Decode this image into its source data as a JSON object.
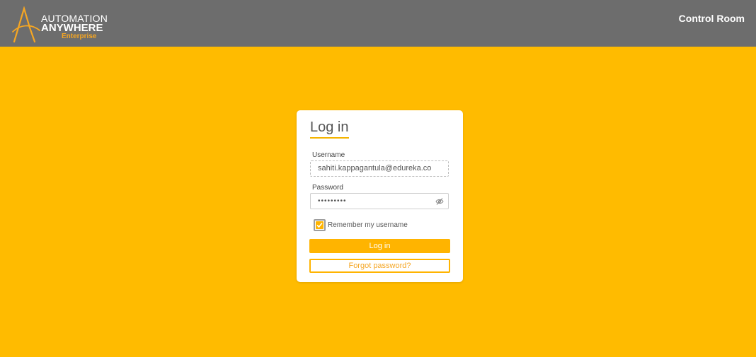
{
  "header": {
    "logo": {
      "line1": "AUTOMATION",
      "line2": "ANYWHERE",
      "line3": "Enterprise"
    },
    "right_link": "Control Room"
  },
  "login": {
    "title": "Log in",
    "username_label": "Username",
    "username_value": "sahiti.kappagantula@edureka.co",
    "password_label": "Password",
    "password_value": "•••••••••",
    "remember_label": "Remember my username",
    "remember_checked": true,
    "login_button": "Log in",
    "forgot_button": "Forgot password?"
  },
  "icons": {
    "logo": "automation-anywhere-logo-icon",
    "eye": "eye-slash-icon",
    "check": "checkmark-icon"
  },
  "colors": {
    "background": "#ffbb00",
    "header": "#6d6d6d",
    "accent": "#ffb400",
    "accent_text": "#f5a623"
  }
}
